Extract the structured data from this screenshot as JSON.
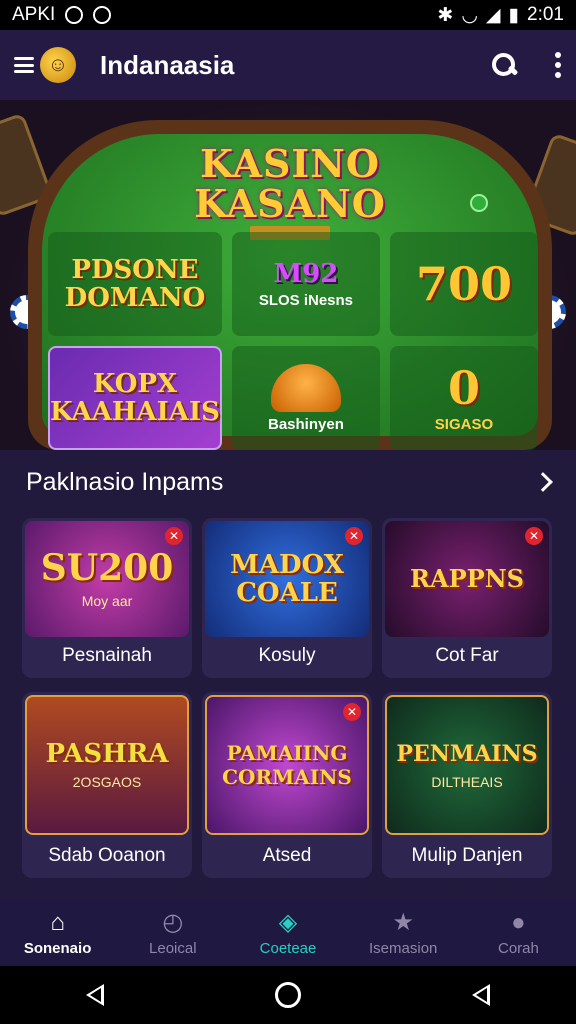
{
  "status_bar": {
    "left_text": "APKI",
    "time": "2:01"
  },
  "app_bar": {
    "title": "Indanaasia"
  },
  "hero": {
    "title_line1": "KASINO",
    "title_line2": "KASANO",
    "tiles": [
      {
        "big": "PDSONE DOMANO",
        "small": ""
      },
      {
        "big": "M92",
        "small": "SLOS iNesns"
      },
      {
        "big": "700",
        "small": ""
      },
      {
        "big": "KOPX KAAHAIAIS",
        "small": ""
      },
      {
        "big": "",
        "small": "Bashinyen"
      },
      {
        "big": "0",
        "small": "SIGASO"
      }
    ]
  },
  "section": {
    "title": "Paklnasio Inpams",
    "cards": [
      {
        "title": "SU200",
        "sub": "Moy aar",
        "label": "Pesnainah"
      },
      {
        "title": "MADOX COALE",
        "sub": "",
        "label": "Kosuly"
      },
      {
        "title": "RAPPNS",
        "sub": "",
        "label": "Cot Far"
      },
      {
        "title": "PASHRA",
        "sub": "2OSGAOS",
        "label": "Sdab Ooanon"
      },
      {
        "title": "PAMAIING CORMAINS",
        "sub": "",
        "label": "Atsed"
      },
      {
        "title": "PENMAINS",
        "sub": "DILTHEAIS",
        "label": "Mulip Danjen"
      }
    ]
  },
  "bottom_nav": [
    {
      "label": "Sonenaio",
      "icon": "home-icon"
    },
    {
      "label": "Leoical",
      "icon": "history-icon"
    },
    {
      "label": "Coeteae",
      "icon": "games-icon"
    },
    {
      "label": "Isemasion",
      "icon": "star-icon"
    },
    {
      "label": "Corah",
      "icon": "profile-icon"
    }
  ],
  "colors": {
    "accent_teal": "#27d0c3",
    "gold": "#ffd34a",
    "background": "#221a3d"
  }
}
